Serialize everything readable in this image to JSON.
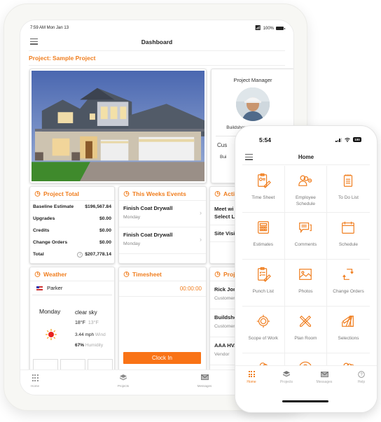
{
  "tablet": {
    "status": {
      "time": "7:59 AM  Mon Jan 13",
      "battery": "100%"
    },
    "header": {
      "title": "Dashboard"
    },
    "project_label": "Project: Sample Project",
    "project_manager": {
      "title": "Project Manager",
      "name": "Buildshop - Joey Richards",
      "customer_label": "Cus",
      "customer_value": "Bui"
    },
    "project_total": {
      "title": "Project Total",
      "rows": [
        {
          "label": "Baseline Estimate",
          "value": "$196,567.84"
        },
        {
          "label": "Upgrades",
          "value": "$0.00"
        },
        {
          "label": "Credits",
          "value": "$0.00"
        },
        {
          "label": "Change Orders",
          "value": "$0.00"
        },
        {
          "label": "Total",
          "value": "$207,778.14"
        }
      ]
    },
    "events": {
      "title": "This Weeks Events",
      "items": [
        {
          "title": "Finish Coat Drywall",
          "day": "Monday"
        },
        {
          "title": "Finish Coat Drywall",
          "day": "Monday"
        }
      ]
    },
    "activity": {
      "title": "Activi",
      "items": [
        {
          "title": "Meet wi\nSelect Li"
        },
        {
          "title": "Site Visi"
        }
      ]
    },
    "weather": {
      "title": "Weather",
      "location": "Parker",
      "day": "Monday",
      "description": "clear sky",
      "temp_high": "18°F",
      "temp_low": "13°F",
      "wind_value": "3.44 mph",
      "wind_label": "Wind",
      "humidity_value": "67%",
      "humidity_label": "Humidity"
    },
    "timesheet": {
      "title": "Timesheet",
      "time": "00:00:00",
      "clock_in_label": "Clock In"
    },
    "projects": {
      "title": "Proje",
      "items": [
        {
          "name": "Rick Jone",
          "role": "Customer"
        },
        {
          "name": "Buildsho",
          "role": "Customer"
        },
        {
          "name": "AAA HVA",
          "role": "Vendor"
        }
      ]
    },
    "tabbar": [
      {
        "label": "Home",
        "icon": "grid-icon"
      },
      {
        "label": "Projects",
        "icon": "layers-icon"
      },
      {
        "label": "Messages",
        "icon": "envelope-icon"
      }
    ]
  },
  "phone": {
    "status": {
      "time": "5:54",
      "battery": "100"
    },
    "header": {
      "title": "Home"
    },
    "grid": [
      {
        "label": "Time Sheet",
        "icon": "timesheet-icon"
      },
      {
        "label": "Employee Schedule",
        "icon": "employee-schedule-icon"
      },
      {
        "label": "To Do List",
        "icon": "notepad-icon"
      },
      {
        "label": "Estimates",
        "icon": "calculator-icon"
      },
      {
        "label": "Comments",
        "icon": "comments-icon"
      },
      {
        "label": "Schedule",
        "icon": "calendar-icon"
      },
      {
        "label": "Punch List",
        "icon": "punch-list-icon"
      },
      {
        "label": "Photos",
        "icon": "photo-icon"
      },
      {
        "label": "Change Orders",
        "icon": "change-orders-icon"
      },
      {
        "label": "Scope of Work",
        "icon": "target-icon"
      },
      {
        "label": "Plan Room",
        "icon": "pencil-ruler-icon"
      },
      {
        "label": "Selections",
        "icon": "swatches-icon"
      },
      {
        "label": "",
        "icon": "users-icon"
      },
      {
        "label": "",
        "icon": "user-circle-icon"
      },
      {
        "label": "",
        "icon": "group-icon"
      }
    ],
    "tabbar": [
      {
        "label": "Home",
        "icon": "grid-icon"
      },
      {
        "label": "Projects",
        "icon": "layers-icon"
      },
      {
        "label": "Messages",
        "icon": "envelope-icon"
      },
      {
        "label": "Help",
        "icon": "help-icon"
      }
    ]
  },
  "colors": {
    "accent": "#f07e1f",
    "button": "#f97316"
  }
}
